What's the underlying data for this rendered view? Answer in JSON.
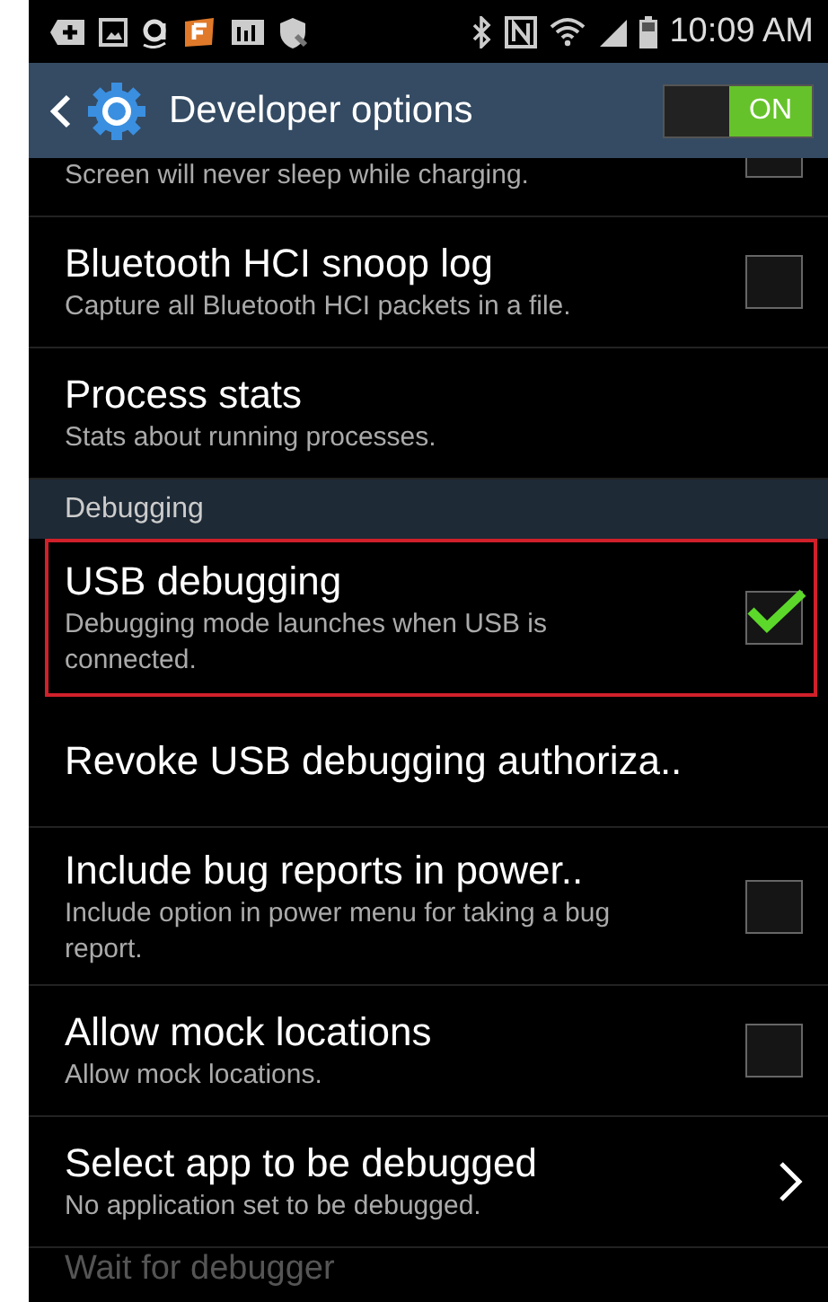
{
  "status_bar": {
    "time": "10:09 AM"
  },
  "action_bar": {
    "title": "Developer options",
    "master_switch": {
      "label": "ON",
      "on": true
    }
  },
  "items": [
    {
      "kind": "checkbox",
      "summary": "Screen will never sleep while charging.",
      "checked": false,
      "highlighted": false,
      "partial": true
    },
    {
      "kind": "checkbox",
      "title": "Bluetooth HCI snoop log",
      "summary": "Capture all Bluetooth HCI packets in a file.",
      "checked": false,
      "highlighted": false
    },
    {
      "kind": "plain",
      "title": "Process stats",
      "summary": "Stats about running processes.",
      "highlighted": false
    },
    {
      "kind": "header",
      "title": "Debugging"
    },
    {
      "kind": "checkbox",
      "title": "USB debugging",
      "summary": "Debugging mode launches when USB is connected.",
      "checked": true,
      "highlighted": true
    },
    {
      "kind": "plain",
      "title": "Revoke USB debugging authoriza..",
      "highlighted": false
    },
    {
      "kind": "checkbox",
      "title": "Include bug reports in power..",
      "summary": "Include option in power menu for taking a bug report.",
      "checked": false,
      "highlighted": false
    },
    {
      "kind": "checkbox",
      "title": "Allow mock locations",
      "summary": "Allow mock locations.",
      "checked": false,
      "highlighted": false
    },
    {
      "kind": "chevron",
      "title": "Select app to be debugged",
      "summary": "No application set to be debugged.",
      "highlighted": false
    },
    {
      "kind": "faded",
      "title": "Wait for debugger"
    }
  ]
}
